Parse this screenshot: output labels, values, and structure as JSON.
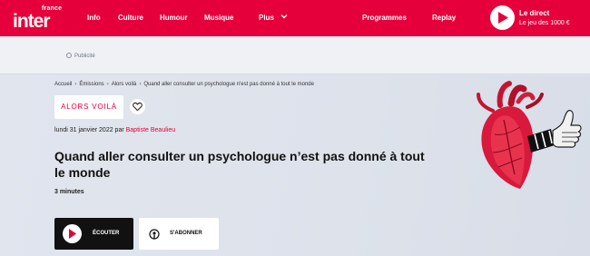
{
  "brand": {
    "logo_small": "france",
    "logo_big": "inter"
  },
  "nav": {
    "items": [
      "Info",
      "Culture",
      "Humour",
      "Musique",
      "Plus"
    ],
    "right_items": [
      "Programmes",
      "Replay"
    ]
  },
  "live": {
    "title": "Le direct",
    "subtitle": "Le jeu des 1000 €"
  },
  "ad": {
    "label": "Publicité"
  },
  "breadcrumb": [
    "Accueil",
    "Émissions",
    "Alors voilà",
    "Quand aller consulter un psychologue n'est pas donné à tout le monde"
  ],
  "show": {
    "name": "ALORS VOILÀ"
  },
  "episode": {
    "date": "lundi 31 janvier 2022 par",
    "author": "Baptiste Beaulieu",
    "title": "Quand aller consulter un psychologue n’est pas donné à tout le monde",
    "duration": "3 minutes"
  },
  "actions": {
    "listen": "ÉCOUTER",
    "subscribe": "S'ABONNER"
  },
  "colors": {
    "brand_red": "#e5003b",
    "dark": "#111111",
    "hero_bg": "#dfe3ec"
  },
  "icons": [
    "play-icon",
    "chevron-down-icon",
    "heart-icon",
    "podcast-icon"
  ]
}
